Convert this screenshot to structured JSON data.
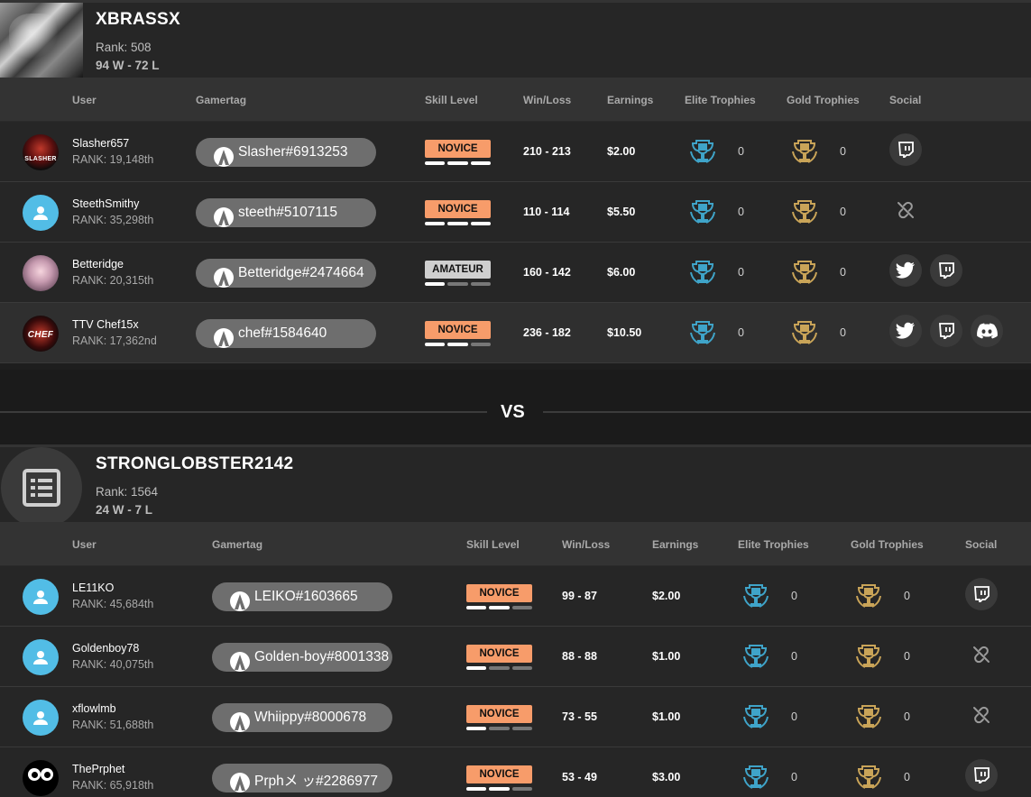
{
  "team1": {
    "name": "XBRASSX",
    "rank": "Rank: 508",
    "record": "94 W - 72 L",
    "headers": {
      "user": "User",
      "gamertag": "Gamertag",
      "skill": "Skill Level",
      "winloss": "Win/Loss",
      "earnings": "Earnings",
      "elite": "Elite Trophies",
      "gold": "Gold Trophies",
      "social": "Social"
    },
    "players": [
      {
        "username": "Slasher657",
        "rank": "RANK: 19,148th",
        "gamertag": "Slasher#6913253",
        "skill": "NOVICE",
        "skill_level": 3,
        "winloss": "210 - 213",
        "earnings": "$2.00",
        "elite": "0",
        "gold": "0",
        "avatar_text": "SLASHER",
        "social": [
          "twitch"
        ]
      },
      {
        "username": "SteethSmithy",
        "rank": "RANK: 35,298th",
        "gamertag": "steeth#5107115",
        "skill": "NOVICE",
        "skill_level": 3,
        "winloss": "110 - 114",
        "earnings": "$5.50",
        "elite": "0",
        "gold": "0",
        "social": [
          "unlinked"
        ]
      },
      {
        "username": "Betteridge",
        "rank": "RANK: 20,315th",
        "gamertag": "Betteridge#2474664",
        "skill": "AMATEUR",
        "skill_level": 1,
        "winloss": "160 - 142",
        "earnings": "$6.00",
        "elite": "0",
        "gold": "0",
        "social": [
          "twitter",
          "twitch"
        ]
      },
      {
        "username": "TTV Chef15x",
        "rank": "RANK: 17,362nd",
        "gamertag": "chef#1584640",
        "skill": "NOVICE",
        "skill_level": 2,
        "winloss": "236 - 182",
        "earnings": "$10.50",
        "elite": "0",
        "gold": "0",
        "avatar_text": "CHEF",
        "social": [
          "twitter",
          "twitch",
          "discord"
        ]
      }
    ]
  },
  "vs_label": "VS",
  "team2": {
    "name": "STRONGLOBSTER2142",
    "rank": "Rank: 1564",
    "record": "24 W - 7 L",
    "headers": {
      "user": "User",
      "gamertag": "Gamertag",
      "skill": "Skill Level",
      "winloss": "Win/Loss",
      "earnings": "Earnings",
      "elite": "Elite Trophies",
      "gold": "Gold Trophies",
      "social": "Social"
    },
    "players": [
      {
        "username": "LE11KO",
        "rank": "RANK: 45,684th",
        "gamertag": "LEIKO#1603665",
        "skill": "NOVICE",
        "skill_level": 2,
        "winloss": "99 - 87",
        "earnings": "$2.00",
        "elite": "0",
        "gold": "0",
        "social": [
          "twitch"
        ]
      },
      {
        "username": "Goldenboy78",
        "rank": "RANK: 40,075th",
        "gamertag": "Golden-boy#8001338",
        "skill": "NOVICE",
        "skill_level": 1,
        "winloss": "88 - 88",
        "earnings": "$1.00",
        "elite": "0",
        "gold": "0",
        "social": [
          "unlinked"
        ]
      },
      {
        "username": "xflowlmb",
        "rank": "RANK: 51,688th",
        "gamertag": "Whiippy#8000678",
        "skill": "NOVICE",
        "skill_level": 1,
        "winloss": "73 - 55",
        "earnings": "$1.00",
        "elite": "0",
        "gold": "0",
        "social": [
          "unlinked"
        ]
      },
      {
        "username": "ThePrphet",
        "rank": "RANK: 65,918th",
        "gamertag": "Prphメ ッ#2286977",
        "skill": "NOVICE",
        "skill_level": 2,
        "winloss": "53 - 49",
        "earnings": "$3.00",
        "elite": "0",
        "gold": "0",
        "social": [
          "twitch"
        ]
      }
    ]
  },
  "colors": {
    "novice": "#f79c6a",
    "amateur": "#cfcfcf",
    "elite_trophy": "#3fa4c9",
    "gold_trophy": "#c9a458",
    "default_avatar": "#52bde6",
    "gamertag_pill": "#6e6e6e"
  }
}
